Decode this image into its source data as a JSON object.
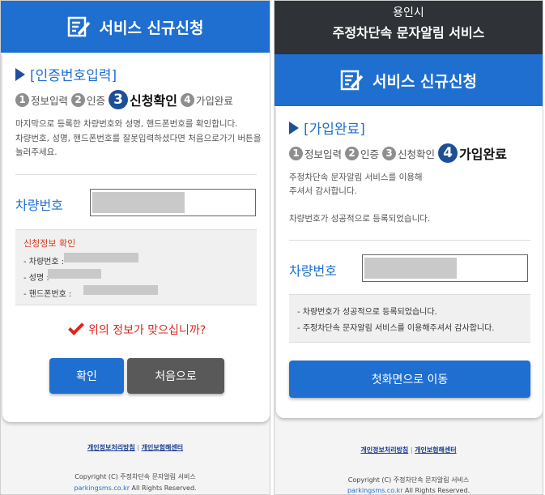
{
  "screen1": {
    "header": {
      "title": "서비스 신규신청",
      "icon": "edit-form-icon"
    },
    "section_title": "[인증번호입력]",
    "steps": [
      {
        "num": "1",
        "label": "정보입력",
        "active": false
      },
      {
        "num": "2",
        "label": "인증",
        "active": false
      },
      {
        "num": "3",
        "label": "신청확인",
        "active": true
      },
      {
        "num": "4",
        "label": "가입완료",
        "active": false
      }
    ],
    "desc1": "마지막으로 등록한 차량번호와 성명, 핸드폰번호를 확인합니다.",
    "desc2a": "차량번호, 성명, 핸드폰번호를 잘못입력하셨다면 처음으로가기 버튼을",
    "desc2b": "눌러주세요.",
    "field_label": "차량번호",
    "info": {
      "title": "신청정보 확인",
      "lines": [
        "- 차량번호 :",
        "- 성명 :",
        "- 핸드폰번호 :"
      ]
    },
    "confirm_question": "위의 정보가 맞으십니까?",
    "confirm_button": "확인",
    "restart_button": "처음으로"
  },
  "screen2": {
    "top": {
      "city": "용인시",
      "service": "주정차단속 문자알림 서비스"
    },
    "header": {
      "title": "서비스 신규신청",
      "icon": "edit-form-icon"
    },
    "section_title": "[가입완료]",
    "steps": [
      {
        "num": "1",
        "label": "정보입력",
        "active": false
      },
      {
        "num": "2",
        "label": "인증",
        "active": false
      },
      {
        "num": "3",
        "label": "신청확인",
        "active": false
      },
      {
        "num": "4",
        "label": "가입완료",
        "active": true
      }
    ],
    "desc1a": "주정차단속 문자알림 서비스를 이용해",
    "desc1b": "주셔서 감사합니다.",
    "desc2": "차량번호가 성공적으로 등록되었습니다.",
    "field_label": "차량번호",
    "info_lines": [
      "- 차량번호가 성공적으로 등록되었습니다.",
      "- 주정차단속 문자알림 서비스를 이용해주셔서 감사합니다."
    ],
    "home_button": "첫화면으로 이동"
  },
  "footer": {
    "privacy_link": "개인정보처리방침",
    "separator": "|",
    "privacy_center": "개인보험해센터",
    "copyright": "Copyright (C) 주정차단속 문자알림 서비스",
    "domain": "parkingsms.co.kr",
    "rights": "All Rights Reserved."
  },
  "colors": {
    "primary": "#1f6fd1",
    "dark_header": "#2f3236",
    "step_active": "#1d4f98",
    "warning": "#d9261c"
  }
}
